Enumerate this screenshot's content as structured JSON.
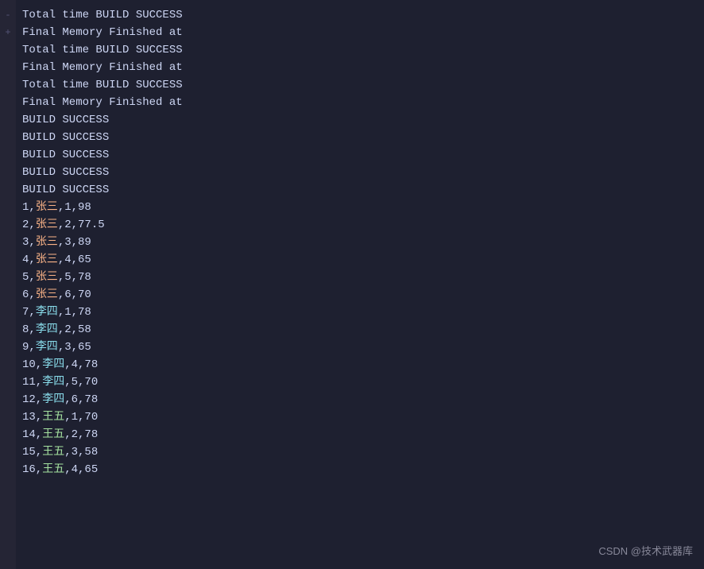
{
  "terminal": {
    "background": "#1e2030",
    "gutter_color": "#252535"
  },
  "lines": [
    {
      "type": "plain",
      "color": "white",
      "text": "Total time BUILD SUCCESS"
    },
    {
      "type": "plain",
      "color": "white",
      "text": "Final Memory Finished at"
    },
    {
      "type": "plain",
      "color": "white",
      "text": "Total time BUILD SUCCESS"
    },
    {
      "type": "plain",
      "color": "white",
      "text": "Final Memory Finished at"
    },
    {
      "type": "plain",
      "color": "white",
      "text": "Total time BUILD SUCCESS"
    },
    {
      "type": "plain",
      "color": "white",
      "text": "Final Memory Finished at"
    },
    {
      "type": "plain",
      "color": "white",
      "text": "BUILD SUCCESS"
    },
    {
      "type": "plain",
      "color": "white",
      "text": "BUILD SUCCESS"
    },
    {
      "type": "plain",
      "color": "white",
      "text": "BUILD SUCCESS"
    },
    {
      "type": "plain",
      "color": "white",
      "text": "BUILD SUCCESS"
    },
    {
      "type": "plain",
      "color": "white",
      "text": "BUILD SUCCESS"
    },
    {
      "type": "mixed",
      "parts": [
        {
          "text": "1,",
          "color": "white"
        },
        {
          "text": "张三",
          "color": "orange"
        },
        {
          "text": ",1,98",
          "color": "white"
        }
      ]
    },
    {
      "type": "mixed",
      "parts": [
        {
          "text": "2,",
          "color": "white"
        },
        {
          "text": "张三",
          "color": "orange"
        },
        {
          "text": ",2,77.5",
          "color": "white"
        }
      ]
    },
    {
      "type": "mixed",
      "parts": [
        {
          "text": "3,",
          "color": "white"
        },
        {
          "text": "张三",
          "color": "orange"
        },
        {
          "text": ",3,89",
          "color": "white"
        }
      ]
    },
    {
      "type": "mixed",
      "parts": [
        {
          "text": "4,",
          "color": "white"
        },
        {
          "text": "张三",
          "color": "orange"
        },
        {
          "text": ",4,65",
          "color": "white"
        }
      ]
    },
    {
      "type": "mixed",
      "parts": [
        {
          "text": "5,",
          "color": "white"
        },
        {
          "text": "张三",
          "color": "orange"
        },
        {
          "text": ",5,78",
          "color": "white"
        }
      ]
    },
    {
      "type": "mixed",
      "parts": [
        {
          "text": "6,",
          "color": "white"
        },
        {
          "text": "张三",
          "color": "orange"
        },
        {
          "text": ",6,70",
          "color": "white"
        }
      ]
    },
    {
      "type": "mixed",
      "parts": [
        {
          "text": "7,",
          "color": "white"
        },
        {
          "text": "李四",
          "color": "cyan"
        },
        {
          "text": ",1,78",
          "color": "white"
        }
      ]
    },
    {
      "type": "mixed",
      "parts": [
        {
          "text": "8,",
          "color": "white"
        },
        {
          "text": "李四",
          "color": "cyan"
        },
        {
          "text": ",2,58",
          "color": "white"
        }
      ]
    },
    {
      "type": "mixed",
      "parts": [
        {
          "text": "9,",
          "color": "white"
        },
        {
          "text": "李四",
          "color": "cyan"
        },
        {
          "text": ",3,65",
          "color": "white"
        }
      ]
    },
    {
      "type": "mixed",
      "parts": [
        {
          "text": "10,",
          "color": "white"
        },
        {
          "text": "李四",
          "color": "cyan"
        },
        {
          "text": ",4,78",
          "color": "white"
        }
      ]
    },
    {
      "type": "mixed",
      "parts": [
        {
          "text": "11,",
          "color": "white"
        },
        {
          "text": "李四",
          "color": "cyan"
        },
        {
          "text": ",5,70",
          "color": "white"
        }
      ]
    },
    {
      "type": "mixed",
      "parts": [
        {
          "text": "12,",
          "color": "white"
        },
        {
          "text": "李四",
          "color": "cyan"
        },
        {
          "text": ",6,78",
          "color": "white"
        }
      ]
    },
    {
      "type": "mixed",
      "parts": [
        {
          "text": "13,",
          "color": "white"
        },
        {
          "text": "王五",
          "color": "green"
        },
        {
          "text": ",1,70",
          "color": "white"
        }
      ]
    },
    {
      "type": "mixed",
      "parts": [
        {
          "text": "14,",
          "color": "white"
        },
        {
          "text": "王五",
          "color": "green"
        },
        {
          "text": ",2,78",
          "color": "white"
        }
      ]
    },
    {
      "type": "mixed",
      "parts": [
        {
          "text": "15,",
          "color": "white"
        },
        {
          "text": "王五",
          "color": "green"
        },
        {
          "text": ",3,58",
          "color": "white"
        }
      ]
    },
    {
      "type": "mixed",
      "parts": [
        {
          "text": "16,",
          "color": "white"
        },
        {
          "text": "王五",
          "color": "green"
        },
        {
          "text": ",4,65",
          "color": "white"
        }
      ]
    }
  ],
  "watermark": {
    "text": "CSDN @技术武器库",
    "color": "#888899"
  },
  "gutter_marks": [
    "-",
    "+",
    "",
    "",
    "",
    "",
    "",
    "",
    "",
    "",
    "",
    "",
    "",
    "",
    "",
    "",
    "",
    "",
    "",
    "",
    "",
    "",
    "",
    "",
    "",
    "",
    ""
  ]
}
